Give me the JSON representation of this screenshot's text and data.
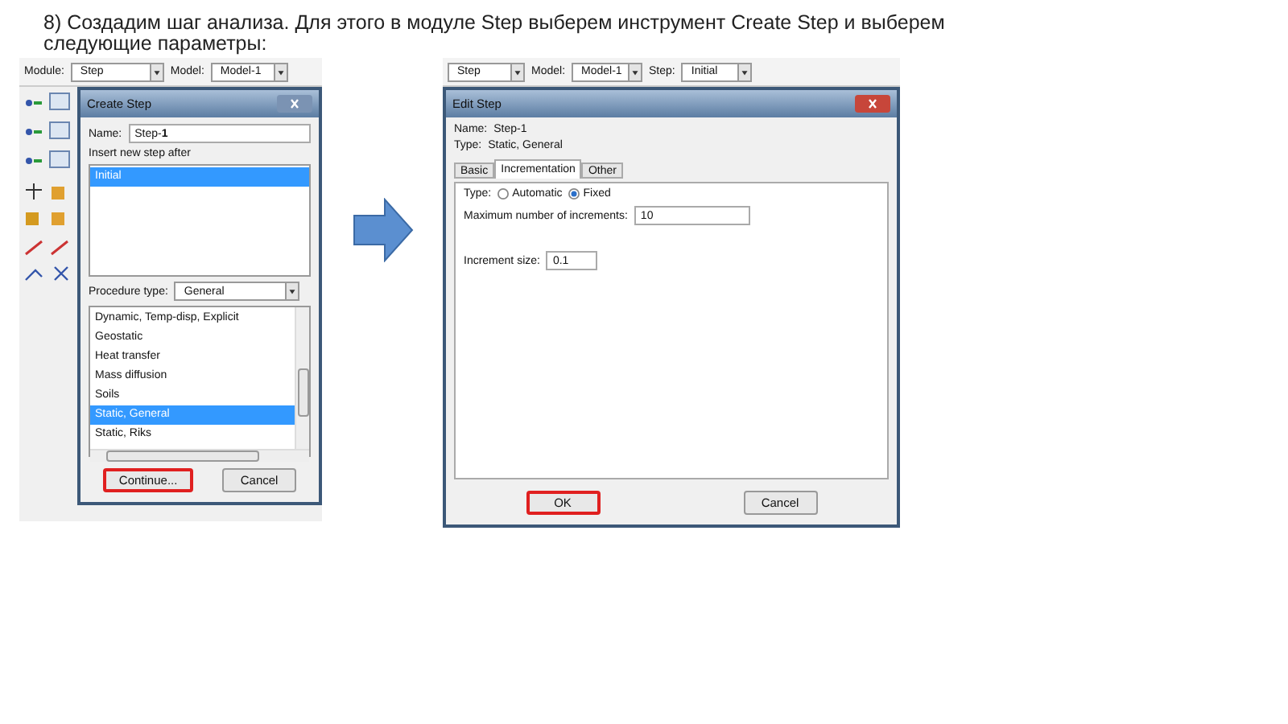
{
  "heading": "8) Создадим шаг анализа. Для этого в модуле Step выберем инструмент Create Step и выберем следующие параметры:",
  "left": {
    "toolbar": {
      "module_label": "Module:",
      "module_value": "Step",
      "model_label": "Model:",
      "model_value": "Model-1"
    },
    "dialog": {
      "title": "Create Step",
      "name_label": "Name:",
      "name_value": "Step-**1**",
      "insert_label": "Insert new step after",
      "steps": [
        {
          "label": "Initial",
          "selected": true
        }
      ],
      "procedure_label": "Procedure type:",
      "procedure_value": "General",
      "procedures": [
        {
          "label": "Dynamic, Temp-disp, Explicit",
          "selected": false
        },
        {
          "label": "Geostatic",
          "selected": false
        },
        {
          "label": "Heat transfer",
          "selected": false
        },
        {
          "label": "Mass diffusion",
          "selected": false
        },
        {
          "label": "Soils",
          "selected": false
        },
        {
          "label": "Static, General",
          "selected": true
        },
        {
          "label": "Static, Riks",
          "selected": false
        }
      ],
      "buttons": [
        {
          "label": "Continue...",
          "highlighted": true
        },
        {
          "label": "Cancel",
          "highlighted": false
        }
      ]
    }
  },
  "right": {
    "toolbar": {
      "module_value": "Step",
      "model_label": "Model:",
      "model_value": "Model-1",
      "step_label": "Step:",
      "step_value": "Initial"
    },
    "dialog": {
      "title": "Edit Step",
      "name_label": "Name:",
      "name_value": "Step-1",
      "type_label": "Type:",
      "type_value": "Static, General",
      "tabs": [
        {
          "label": "Basic",
          "selected": false
        },
        {
          "label": "Incrementation",
          "selected": true
        },
        {
          "label": "Other",
          "selected": false
        }
      ],
      "increment_type_label": "Type:",
      "type_options": [
        {
          "label": "Automatic",
          "selected": false
        },
        {
          "label": "Fixed",
          "selected": true
        }
      ],
      "max_label": "Maximum number of increments:",
      "max_value": "10",
      "size_label": "Increment size:",
      "size_value": "0.1",
      "buttons": [
        {
          "label": "OK",
          "highlighted": true
        },
        {
          "label": "Cancel",
          "highlighted": false
        }
      ]
    }
  }
}
